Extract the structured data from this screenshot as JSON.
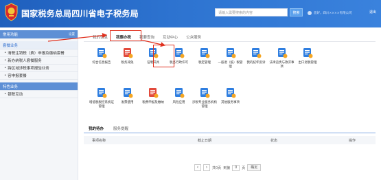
{
  "header": {
    "title": "国家税务总局四川省电子税务局",
    "search_placeholder": "请输入需要搜索的内容",
    "search_label": "搜索",
    "user_text": "您好，四川××××有限公司",
    "exit_label": "退出"
  },
  "sidebar": {
    "head_label": "常用功能",
    "head_tools": "设置",
    "section_label": "套餐业务",
    "items": [
      {
        "label": "清税注销税（费）申报及缴纳套餐"
      },
      {
        "label": "新办纳税人套餐服务"
      },
      {
        "label": "跨区域涉税事项报验业务"
      },
      {
        "label": "容申报套餐"
      }
    ],
    "special_label": "特色业务",
    "special_items": [
      {
        "label": "银税互动"
      }
    ]
  },
  "tabs": [
    {
      "label": "我的信息"
    },
    {
      "label": "我要办税"
    },
    {
      "label": "我要查询"
    },
    {
      "label": "互动中心"
    },
    {
      "label": "公众服务"
    }
  ],
  "services": [
    {
      "label": "综合信息报告",
      "icon": "monitor-icon",
      "color": "#2f7ee0"
    },
    {
      "label": "税务减免",
      "icon": "document-stamp-icon",
      "color": "#e24a3c"
    },
    {
      "label": "证明开具",
      "icon": "certificate-icon",
      "color": "#2f7ee0"
    },
    {
      "label": "税务行政许可",
      "icon": "license-icon",
      "color": "#2f7ee0"
    },
    {
      "label": "税定管理",
      "icon": "person-settings-icon",
      "color": "#2f7ee0"
    },
    {
      "label": "一般退（抵）税管理",
      "icon": "hand-coin-icon",
      "color": "#2f7ee0"
    },
    {
      "label": "我的纪年反诉",
      "icon": "clipboard-icon",
      "color": "#2f7ee0"
    },
    {
      "label": "法律追责与救济事项",
      "icon": "legal-person-icon",
      "color": "#2f7ee0"
    },
    {
      "label": "出口退税管理",
      "icon": "export-icon",
      "color": "#2f7ee0"
    },
    {
      "label": "增值税税控系统证管理",
      "icon": "tax-control-icon",
      "color": "#2f7ee0"
    },
    {
      "label": "发票使用",
      "icon": "invoice-icon",
      "color": "#2f7ee0"
    },
    {
      "label": "税费申报及缴纳",
      "icon": "calculator-icon",
      "color": "#e24a3c"
    },
    {
      "label": "风险应用",
      "icon": "risk-person-icon",
      "color": "#2f7ee0"
    },
    {
      "label": "涉税专业服务机构管理",
      "icon": "agency-icon",
      "color": "#2f7ee0"
    },
    {
      "label": "其他服务事项",
      "icon": "other-services-icon",
      "color": "#2f7ee0"
    }
  ],
  "todo": {
    "tabs": [
      {
        "label": "我的待办"
      },
      {
        "label": "服务提醒"
      }
    ],
    "columns": [
      "事项名称",
      "截止日期",
      "状态",
      "操作"
    ]
  },
  "pager": {
    "prev": "‹",
    "next": "›",
    "total_text": "共0页",
    "goto_text": "到第",
    "page_value": "0",
    "page_unit": "页",
    "confirm_label": "确定"
  },
  "colors": {
    "header_blue": "#2d73d0",
    "highlight_red": "#e0301e",
    "accent_blue": "#2f7ee0"
  }
}
